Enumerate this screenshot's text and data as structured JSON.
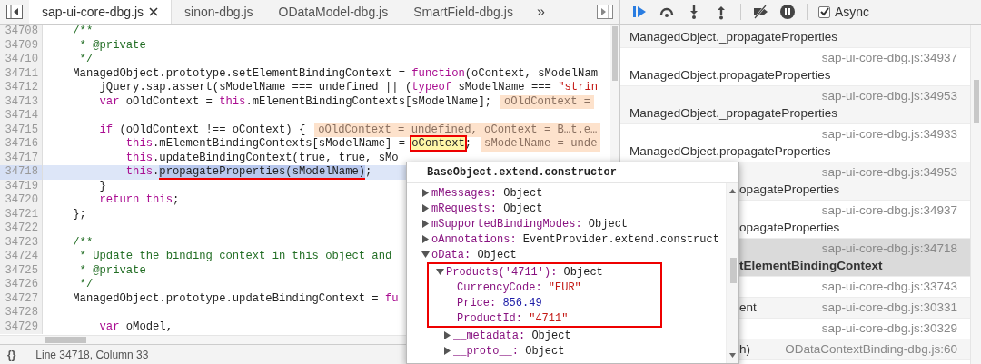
{
  "source_tabs": {
    "tabs": [
      {
        "label": "sap-ui-core-dbg.js",
        "selected": true,
        "closable": true
      },
      {
        "label": "sinon-dbg.js",
        "selected": false
      },
      {
        "label": "ODataModel-dbg.js",
        "selected": false
      },
      {
        "label": "SmartField-dbg.js",
        "selected": false
      }
    ],
    "overflow": "»"
  },
  "editor": {
    "lines": [
      {
        "number": "34708",
        "selected": false,
        "segments": [
          {
            "kind": "comment",
            "text": "    /**"
          }
        ]
      },
      {
        "number": "34709",
        "selected": false,
        "segments": [
          {
            "kind": "comment",
            "text": "     * @private"
          }
        ]
      },
      {
        "number": "34710",
        "selected": false,
        "segments": [
          {
            "kind": "comment",
            "text": "     */"
          }
        ]
      },
      {
        "number": "34711",
        "selected": false,
        "segments": [
          {
            "kind": "code",
            "text": "    ManagedObject.prototype.setElementBindingContext = "
          },
          {
            "kind": "keyword",
            "text": "function"
          },
          {
            "kind": "code",
            "text": "(oContext, sModelNam"
          }
        ]
      },
      {
        "number": "34712",
        "selected": false,
        "segments": [
          {
            "kind": "code",
            "text": "        jQuery.sap.assert(sModelName === undefined || ("
          },
          {
            "kind": "keyword",
            "text": "typeof"
          },
          {
            "kind": "code",
            "text": " sModelName === "
          },
          {
            "kind": "string",
            "text": "\"strin"
          }
        ]
      },
      {
        "number": "34713",
        "selected": false,
        "segments": [
          {
            "kind": "keyword",
            "text": "        var"
          },
          {
            "kind": "code",
            "text": " oOldContext = "
          },
          {
            "kind": "keyword",
            "text": "this"
          },
          {
            "kind": "code",
            "text": ".mElementBindingContexts[sModelName];"
          }
        ],
        "inline_value": "oOldContext ="
      },
      {
        "number": "34714",
        "selected": false
      },
      {
        "number": "34715",
        "selected": false,
        "segments": [
          {
            "kind": "keyword",
            "text": "        if"
          },
          {
            "kind": "code",
            "text": " (oOldContext !== oContext) {"
          }
        ],
        "inline_value": "oOldContext = undefined, oContext = B…t.e…"
      },
      {
        "number": "34716",
        "selected": false,
        "segments": [
          {
            "kind": "keyword",
            "text": "            this"
          },
          {
            "kind": "code",
            "text": ".mElementBindingContexts[sModelName] = "
          },
          {
            "kind": "code",
            "text": "oContext",
            "boxed": true
          },
          {
            "kind": "code",
            "text": ";"
          }
        ],
        "inline_value": "sModelName = unde"
      },
      {
        "number": "34717",
        "selected": false,
        "segments": [
          {
            "kind": "keyword",
            "text": "            this"
          },
          {
            "kind": "code",
            "text": ".updateBindingContext(true, true, sMo"
          }
        ]
      },
      {
        "number": "34718",
        "selected": true,
        "segments": [
          {
            "kind": "keyword",
            "text": "            this"
          },
          {
            "kind": "code",
            "text": "."
          },
          {
            "kind": "code",
            "text": "propagateProperties(sModelName)",
            "underlined": true
          },
          {
            "kind": "code",
            "text": ";"
          }
        ]
      },
      {
        "number": "34719",
        "selected": false,
        "segments": [
          {
            "kind": "code",
            "text": "        }"
          }
        ]
      },
      {
        "number": "34720",
        "selected": false,
        "segments": [
          {
            "kind": "keyword",
            "text": "        return this"
          },
          {
            "kind": "code",
            "text": ";"
          }
        ]
      },
      {
        "number": "34721",
        "selected": false,
        "segments": [
          {
            "kind": "code",
            "text": "    };"
          }
        ]
      },
      {
        "number": "34722",
        "selected": false
      },
      {
        "number": "34723",
        "selected": false,
        "segments": [
          {
            "kind": "comment",
            "text": "    /**"
          }
        ]
      },
      {
        "number": "34724",
        "selected": false,
        "segments": [
          {
            "kind": "comment",
            "text": "     * Update the binding context in this object and"
          }
        ]
      },
      {
        "number": "34725",
        "selected": false,
        "segments": [
          {
            "kind": "comment",
            "text": "     * @private"
          }
        ]
      },
      {
        "number": "34726",
        "selected": false,
        "segments": [
          {
            "kind": "comment",
            "text": "     */"
          }
        ]
      },
      {
        "number": "34727",
        "selected": false,
        "segments": [
          {
            "kind": "code",
            "text": "    ManagedObject.prototype.updateBindingContext = "
          },
          {
            "kind": "keyword",
            "text": "fu"
          }
        ]
      },
      {
        "number": "34728",
        "selected": false
      },
      {
        "number": "34729",
        "selected": false,
        "segments": [
          {
            "kind": "keyword",
            "text": "        var"
          },
          {
            "kind": "code",
            "text": " oModel,"
          }
        ]
      }
    ]
  },
  "status_bar": {
    "braces": "{}",
    "position": "Line 34718, Column 33"
  },
  "popover": {
    "title": "BaseObject.extend.constructor",
    "properties": [
      {
        "key": "mMessages:",
        "value": "Object",
        "kind": "object",
        "expanded": false
      },
      {
        "key": "mRequests:",
        "value": "Object",
        "kind": "object",
        "expanded": false
      },
      {
        "key": "mSupportedBindingModes:",
        "value": "Object",
        "kind": "object",
        "expanded": false
      },
      {
        "key": "oAnnotations:",
        "value": "EventProvider.extend.construct",
        "kind": "object",
        "expanded": false
      },
      {
        "key": "oData:",
        "value": "Object",
        "kind": "object",
        "expanded": true,
        "children": [
          {
            "key": "Products('4711'):",
            "value": "Object",
            "kind": "object",
            "expanded": true,
            "boxed": true,
            "children": [
              {
                "key": "CurrencyCode:",
                "value": "\"EUR\"",
                "kind": "string"
              },
              {
                "key": "Price:",
                "value": "856.49",
                "kind": "number"
              },
              {
                "key": "ProductId:",
                "value": "\"4711\"",
                "kind": "string"
              },
              {
                "key": "__metadata:",
                "value": "Object",
                "kind": "object",
                "expanded": false
              },
              {
                "key": "__proto__:",
                "value": "Object",
                "kind": "object",
                "expanded": false
              }
            ]
          }
        ]
      }
    ]
  },
  "debugger_toolbar": {
    "async": {
      "label": "Async",
      "checked": true
    }
  },
  "call_stack": [
    {
      "kind": "stacked",
      "name": "ManagedObject._propagateProperties",
      "selected": false,
      "covered": false
    },
    {
      "kind": "stacked",
      "name": "ManagedObject.propagateProperties",
      "location": "sap-ui-core-dbg.js:34937",
      "selected": false,
      "covered": false
    },
    {
      "kind": "stacked",
      "name": "ManagedObject._propagateProperties",
      "location": "sap-ui-core-dbg.js:34953",
      "selected": false,
      "covered": false
    },
    {
      "kind": "stacked",
      "name": "ManagedObject.propagateProperties",
      "location": "sap-ui-core-dbg.js:34933",
      "selected": false,
      "covered": false
    },
    {
      "kind": "stacked",
      "name": "opagateProperties",
      "location": "sap-ui-core-dbg.js:34953",
      "selected": false,
      "covered": true
    },
    {
      "kind": "stacked",
      "name": "opagateProperties",
      "location": "sap-ui-core-dbg.js:34937",
      "selected": false,
      "covered": true
    },
    {
      "kind": "stacked",
      "name": "tElementBindingContext",
      "location": "sap-ui-core-dbg.js:34718",
      "selected": true,
      "covered": true
    },
    {
      "kind": "inline",
      "location": "sap-ui-core-dbg.js:33743",
      "selected": false
    },
    {
      "kind": "inline",
      "name": "ent",
      "location": "sap-ui-core-dbg.js:30331",
      "selected": false,
      "covered": true
    },
    {
      "kind": "inline",
      "location": "sap-ui-core-dbg.js:30329",
      "selected": false
    },
    {
      "kind": "inline",
      "name": "h)",
      "location": "ODataContextBinding-dbg.js:60",
      "selected": false,
      "covered": true
    }
  ]
}
